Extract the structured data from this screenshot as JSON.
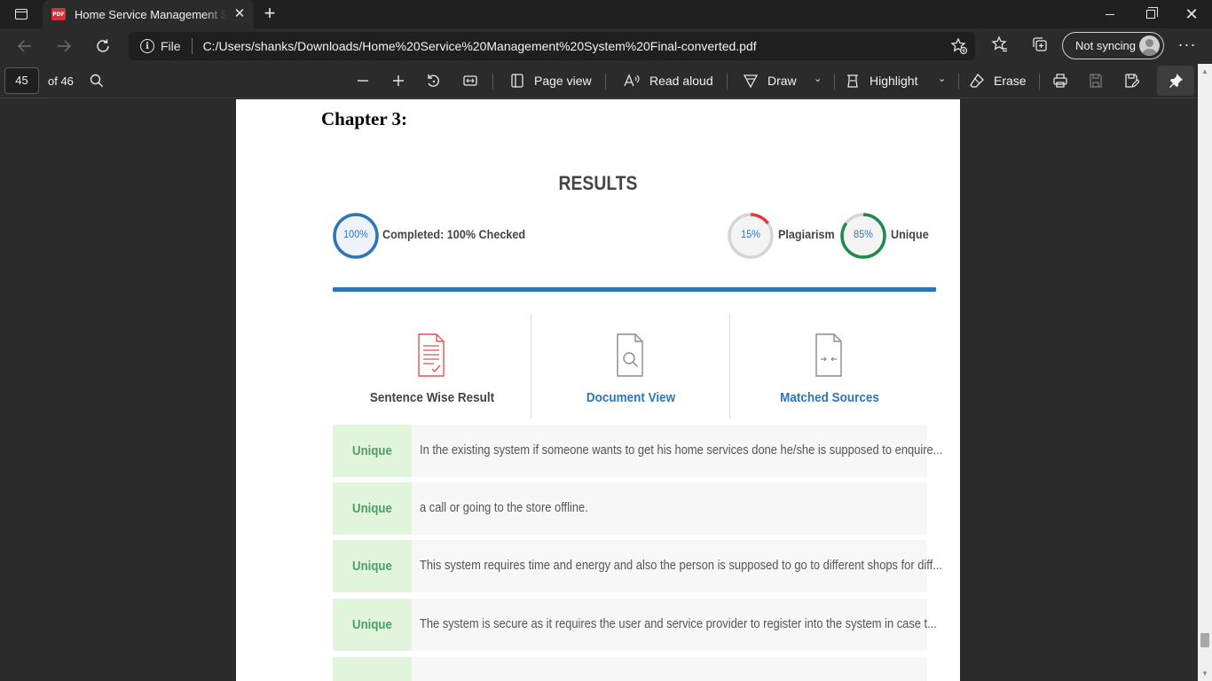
{
  "browser": {
    "tab_title": "Home Service Management System Final-converted.pdf",
    "file_label": "File",
    "url": "C:/Users/shanks/Downloads/Home%20Service%20Management%20System%20Final-converted.pdf",
    "sync_label": "Not syncing"
  },
  "pdf_toolbar": {
    "page_number": "45",
    "page_of": "of 46",
    "page_view": "Page view",
    "read_aloud": "Read aloud",
    "draw": "Draw",
    "highlight": "Highlight",
    "erase": "Erase"
  },
  "document": {
    "chapter": "Chapter 3:",
    "results_title": "RESULTS",
    "completed": {
      "value": "100%",
      "label": "Completed: 100% Checked",
      "fraction": 1.0
    },
    "plagiarism": {
      "value": "15%",
      "label": "Plagiarism",
      "fraction": 0.15
    },
    "unique": {
      "value": "85%",
      "label": "Unique",
      "fraction": 0.85
    },
    "views": [
      {
        "label": "Sentence Wise Result",
        "color": "#444444"
      },
      {
        "label": "Document View",
        "color": "#2e75b6"
      },
      {
        "label": "Matched Sources",
        "color": "#2e75b6"
      }
    ],
    "rows": [
      {
        "badge": "Unique",
        "text": "In the existing system if someone wants to get his home services done he/she is supposed to enquire..."
      },
      {
        "badge": "Unique",
        "text": "a call or going to the store offline."
      },
      {
        "badge": "Unique",
        "text": "This system requires time and energy and also the person is supposed to go to different shops for diff..."
      },
      {
        "badge": "Unique",
        "text": "The system is secure as it requires the user and service provider to register into the system in case t..."
      }
    ]
  },
  "colors": {
    "accent_blue": "#2e75b6",
    "plagiarism_red": "#e03b3b",
    "unique_green": "#1e8a4c",
    "badge_bg": "#e0f5dc"
  }
}
